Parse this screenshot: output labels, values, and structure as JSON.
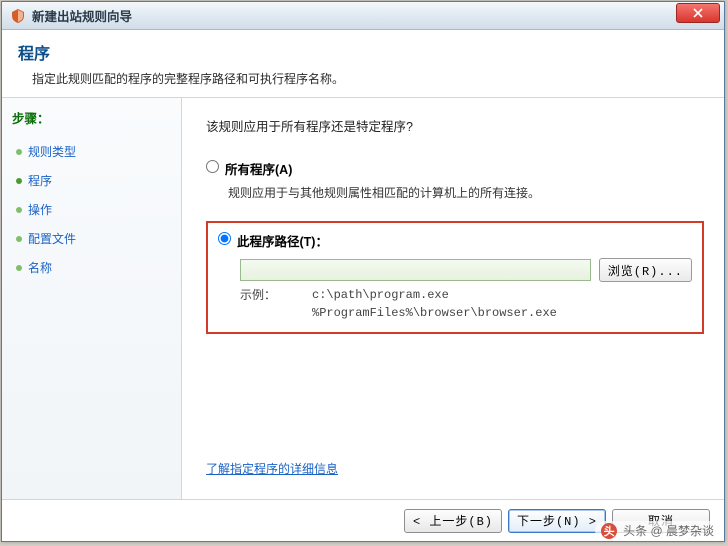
{
  "titlebar": {
    "title": "新建出站规则向导"
  },
  "header": {
    "title": "程序",
    "subtitle": "指定此规则匹配的程序的完整程序路径和可执行程序名称。"
  },
  "sidebar": {
    "steps_label": "步骤：",
    "items": [
      {
        "label": "规则类型",
        "link": true
      },
      {
        "label": "程序",
        "link": true,
        "current": true
      },
      {
        "label": "操作",
        "link": true
      },
      {
        "label": "配置文件",
        "link": true
      },
      {
        "label": "名称",
        "link": true
      }
    ]
  },
  "main": {
    "question": "该规则应用于所有程序还是特定程序?",
    "option_all": {
      "label": "所有程序(A)",
      "desc": "规则应用于与其他规则属性相匹配的计算机上的所有连接。"
    },
    "option_path": {
      "label": "此程序路径(T)：",
      "value": "",
      "placeholder": "",
      "browse_label": "浏览(R)...",
      "example_label": "示例：",
      "example_paths": "c:\\path\\program.exe\n%ProgramFiles%\\browser\\browser.exe"
    },
    "info_link": "了解指定程序的详细信息"
  },
  "footer": {
    "back_label": "< 上一步(B)",
    "next_label": "下一步(N) >",
    "cancel_label": "取消"
  },
  "watermark": {
    "text": "头条 @ 晨梦杂谈"
  }
}
